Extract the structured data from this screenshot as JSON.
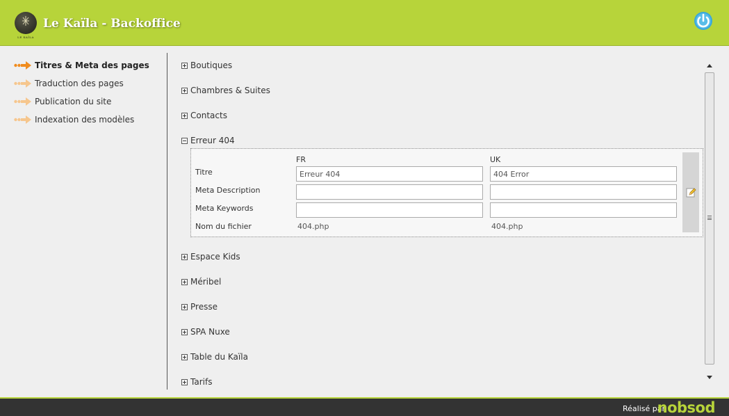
{
  "header": {
    "app_title": "Le Kaïla - Backoffice",
    "logo_text": "LE KAÏLA",
    "accent_color": "#b7d43a",
    "power_icon": "power-icon"
  },
  "sidebar": {
    "items": [
      {
        "label": "Titres & Meta des pages",
        "active": true
      },
      {
        "label": "Traduction des pages",
        "active": false
      },
      {
        "label": "Publication du site",
        "active": false
      },
      {
        "label": "Indexation des modèles",
        "active": false
      }
    ]
  },
  "content": {
    "groups": [
      {
        "label": "Boutiques",
        "expanded": false
      },
      {
        "label": "Chambres & Suites",
        "expanded": false
      },
      {
        "label": "Contacts",
        "expanded": false
      },
      {
        "label": "Erreur 404",
        "expanded": true
      },
      {
        "label": "Espace Kids",
        "expanded": false
      },
      {
        "label": "Méribel",
        "expanded": false
      },
      {
        "label": "Presse",
        "expanded": false
      },
      {
        "label": "SPA Nuxe",
        "expanded": false
      },
      {
        "label": "Table du Kaïla",
        "expanded": false
      },
      {
        "label": "Tarifs",
        "expanded": false
      }
    ],
    "panel": {
      "columns": [
        "FR",
        "UK"
      ],
      "fields": {
        "titre_label": "Titre",
        "meta_description_label": "Meta Description",
        "meta_keywords_label": "Meta Keywords",
        "nom_fichier_label": "Nom du fichier"
      },
      "values": {
        "titre_fr": "Erreur 404",
        "titre_uk": "404 Error",
        "meta_description_fr": "",
        "meta_description_uk": "",
        "meta_keywords_fr": "",
        "meta_keywords_uk": "",
        "fichier_fr": "404.php",
        "fichier_uk": "404.php"
      },
      "edit_icon": "pencil-edit-icon"
    }
  },
  "footer": {
    "text": "Réalisé par",
    "brand": "nobsod"
  }
}
